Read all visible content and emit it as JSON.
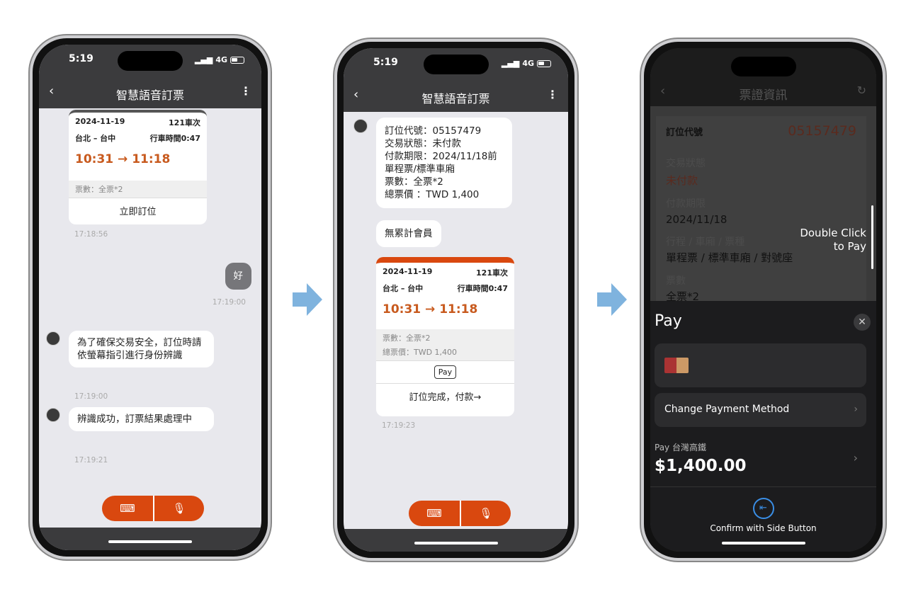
{
  "status": {
    "time": "5:19",
    "network": "4G"
  },
  "arrow_color": "#7fb3de",
  "accent": "#d9480f",
  "phone1": {
    "title": "智慧語音訂票",
    "ticket": {
      "date": "2024-11-19",
      "train": "121車次",
      "route": "台北 – 台中",
      "duration": "行車時間0:47",
      "times": "10:31 → 11:18",
      "count": "票數：全票*2",
      "action": "立即訂位",
      "timestamp": "17:18:56"
    },
    "user_msg": {
      "text": "好",
      "timestamp": "17:19:00"
    },
    "messages": [
      {
        "text": "為了確保交易安全，訂位時請依螢幕指引進行身份辨識",
        "timestamp": "17:19:00"
      },
      {
        "text": "辨識成功，訂票結果處理中",
        "timestamp": "17:19:21"
      }
    ]
  },
  "phone2": {
    "title": "智慧語音訂票",
    "summary": [
      "訂位代號：05157479",
      "交易狀態：未付款",
      "付款期限：2024/11/18前",
      "單程票/標準車廂",
      "票數：全票*2",
      "總票價 ：TWD 1,400"
    ],
    "member": "無累計會員",
    "ticket": {
      "date": "2024-11-19",
      "train": "121車次",
      "route": "台北 – 台中",
      "duration": "行車時間0:47",
      "times": "10:31 → 11:18",
      "count": "票數：全票*2",
      "total": "總票價：TWD 1,400",
      "pay_badge": "Pay",
      "action": "訂位完成，付款→",
      "timestamp": "17:19:23"
    }
  },
  "phone3": {
    "title": "票證資訊",
    "fields": {
      "code_label": "訂位代號",
      "code": "05157479",
      "status_label": "交易狀態",
      "status": "未付款",
      "deadline_label": "付款期限",
      "deadline": "2024/11/18",
      "type_label": "行程 / 車廂 / 票種",
      "type": "單程票 / 標準車廂 / 對號座",
      "count_label": "票數",
      "count": "全票*2"
    },
    "hint": [
      "Double Click",
      "to Pay"
    ],
    "applepay": {
      "logo": "Pay",
      "change": "Change Payment Method",
      "merchant": "Pay 台灣高鐵",
      "amount": "$1,400.00",
      "confirm": "Confirm with Side Button"
    }
  }
}
